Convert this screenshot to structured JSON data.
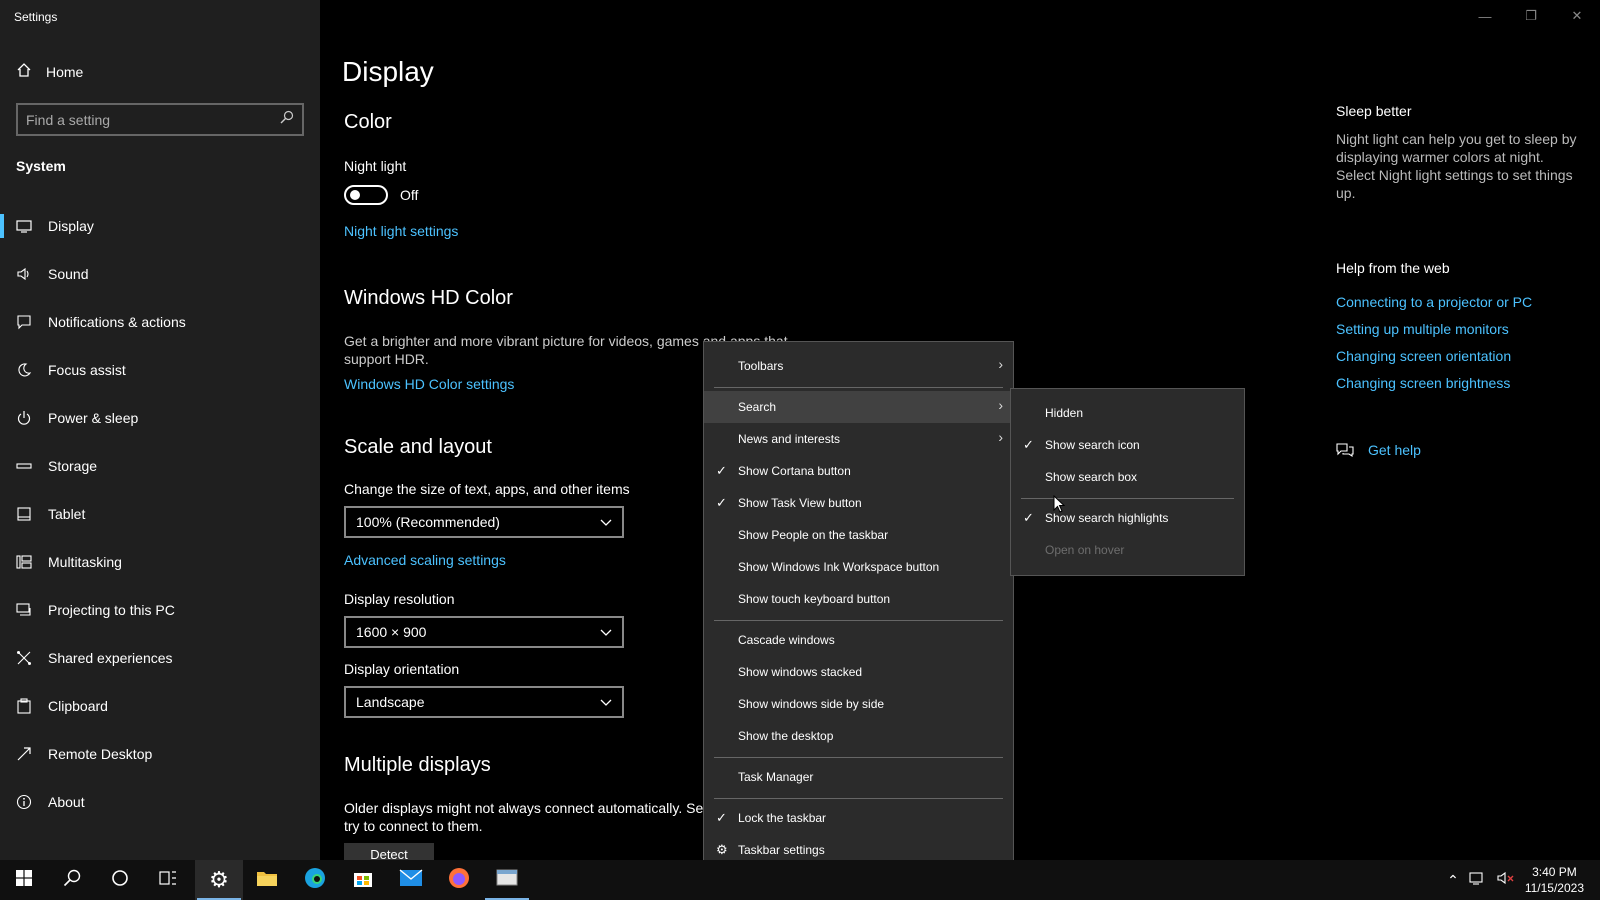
{
  "window": {
    "title": "Settings"
  },
  "sidebar": {
    "home": "Home",
    "search_placeholder": "Find a setting",
    "section": "System",
    "items": [
      {
        "label": "Display",
        "icon": "monitor-icon"
      },
      {
        "label": "Sound",
        "icon": "speaker-icon"
      },
      {
        "label": "Notifications & actions",
        "icon": "notification-icon"
      },
      {
        "label": "Focus assist",
        "icon": "moon-icon"
      },
      {
        "label": "Power & sleep",
        "icon": "power-icon"
      },
      {
        "label": "Storage",
        "icon": "storage-icon"
      },
      {
        "label": "Tablet",
        "icon": "tablet-icon"
      },
      {
        "label": "Multitasking",
        "icon": "multitasking-icon"
      },
      {
        "label": "Projecting to this PC",
        "icon": "projector-icon"
      },
      {
        "label": "Shared experiences",
        "icon": "share-icon"
      },
      {
        "label": "Clipboard",
        "icon": "clipboard-icon"
      },
      {
        "label": "Remote Desktop",
        "icon": "remote-icon"
      },
      {
        "label": "About",
        "icon": "info-icon"
      }
    ]
  },
  "main": {
    "title": "Display",
    "color": {
      "heading": "Color",
      "night_light_label": "Night light",
      "night_light_state": "Off",
      "night_light_link": "Night light settings"
    },
    "hdr": {
      "heading": "Windows HD Color",
      "desc": "Get a brighter and more vibrant picture for videos, games and apps that support HDR.",
      "link": "Windows HD Color settings"
    },
    "scale": {
      "heading": "Scale and layout",
      "size_label": "Change the size of text, apps, and other items",
      "size_value": "100% (Recommended)",
      "advanced_link": "Advanced scaling settings",
      "resolution_label": "Display resolution",
      "resolution_value": "1600 × 900",
      "orientation_label": "Display orientation",
      "orientation_value": "Landscape"
    },
    "multi": {
      "heading": "Multiple displays",
      "desc": "Older displays might not always connect automatically. Se try to connect to them.",
      "detect": "Detect"
    }
  },
  "right_pane": {
    "sleep_title": "Sleep better",
    "sleep_desc": "Night light can help you get to sleep by displaying warmer colors at night. Select Night light settings to set things up.",
    "help_title": "Help from the web",
    "links": [
      "Connecting to a projector or PC",
      "Setting up multiple monitors",
      "Changing screen orientation",
      "Changing screen brightness"
    ],
    "get_help": "Get help"
  },
  "context_menu": {
    "items": [
      {
        "label": "Toolbars",
        "checked": false,
        "submenu": true
      },
      {
        "label": "Search",
        "checked": false,
        "submenu": true
      },
      {
        "label": "News and interests",
        "checked": false,
        "submenu": true
      },
      {
        "label": "Show Cortana button",
        "checked": true
      },
      {
        "label": "Show Task View button",
        "checked": true
      },
      {
        "label": "Show People on the taskbar",
        "checked": false
      },
      {
        "label": "Show Windows Ink Workspace button",
        "checked": false
      },
      {
        "label": "Show touch keyboard button",
        "checked": false
      },
      {
        "label": "Cascade windows",
        "checked": false
      },
      {
        "label": "Show windows stacked",
        "checked": false
      },
      {
        "label": "Show windows side by side",
        "checked": false
      },
      {
        "label": "Show the desktop",
        "checked": false
      },
      {
        "label": "Task Manager",
        "checked": false
      },
      {
        "label": "Lock the taskbar",
        "checked": true
      },
      {
        "label": "Taskbar settings",
        "checked": false,
        "icon": "gear-icon"
      }
    ]
  },
  "search_submenu": {
    "items": [
      {
        "label": "Hidden",
        "checked": false
      },
      {
        "label": "Show search icon",
        "checked": true
      },
      {
        "label": "Show search box",
        "checked": false
      },
      {
        "label": "Show search highlights",
        "checked": true
      },
      {
        "label": "Open on hover",
        "checked": false,
        "disabled": true
      }
    ]
  },
  "taskbar": {
    "time": "3:40 PM",
    "date": "11/15/2023"
  },
  "colors": {
    "accent": "#4cc2ff",
    "sidebar_bg": "#1f1f1f",
    "menu_bg": "#2b2b2b"
  }
}
